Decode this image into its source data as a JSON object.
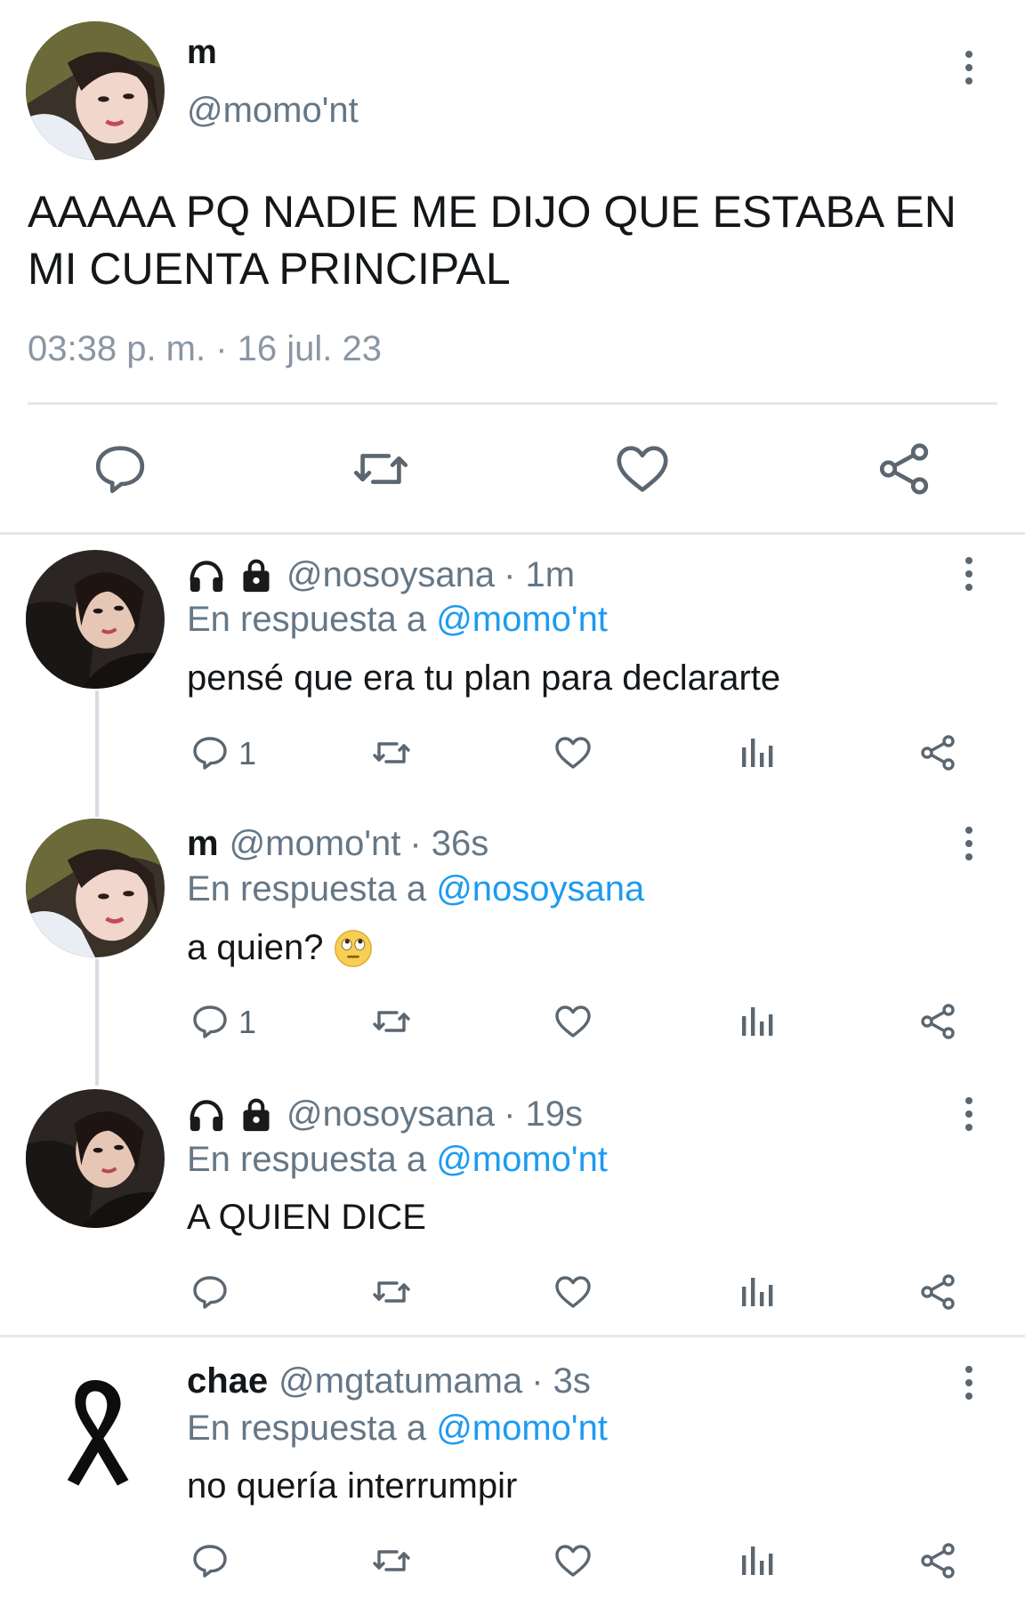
{
  "main_tweet": {
    "name": "m",
    "handle": "@momo'nt",
    "text": "AAAAA PQ NADIE ME DIJO QUE ESTABA EN MI CUENTA PRINCIPAL",
    "timestamp": "03:38 p. m. · 16 jul. 23",
    "actions": [
      "reply-icon",
      "retweet-icon",
      "like-icon",
      "share-icon"
    ]
  },
  "replies": [
    {
      "name": "",
      "badges": [
        "headphones-icon",
        "lock-icon"
      ],
      "handle": "@nosoysana",
      "time": "· 1m",
      "reply_prefix": "En respuesta a",
      "reply_target": "@momo'nt",
      "text": "pensé que era tu plan para declararte",
      "reply_count": "1"
    },
    {
      "name": "m",
      "handle": "@momo'nt",
      "time": "· 36s",
      "reply_prefix": "En respuesta a",
      "reply_target": "@nosoysana",
      "text": "a quien?",
      "emoji": "face-with-rolling-eyes",
      "reply_count": "1"
    },
    {
      "name": "",
      "badges": [
        "headphones-icon",
        "lock-icon"
      ],
      "handle": "@nosoysana",
      "time": "· 19s",
      "reply_prefix": "En respuesta a",
      "reply_target": "@momo'nt",
      "text": "A QUIEN DICE",
      "reply_count": ""
    },
    {
      "name": "chae",
      "handle": "@mgtatumama",
      "time": "· 3s",
      "reply_prefix": "En respuesta a",
      "reply_target": "@momo'nt",
      "text": "no quería interrumpir",
      "reply_count": ""
    }
  ],
  "colors": {
    "link": "#1d9bf0",
    "secondary_text": "#657786",
    "icon": "#5b6670",
    "divider": "#e3e8ec"
  }
}
